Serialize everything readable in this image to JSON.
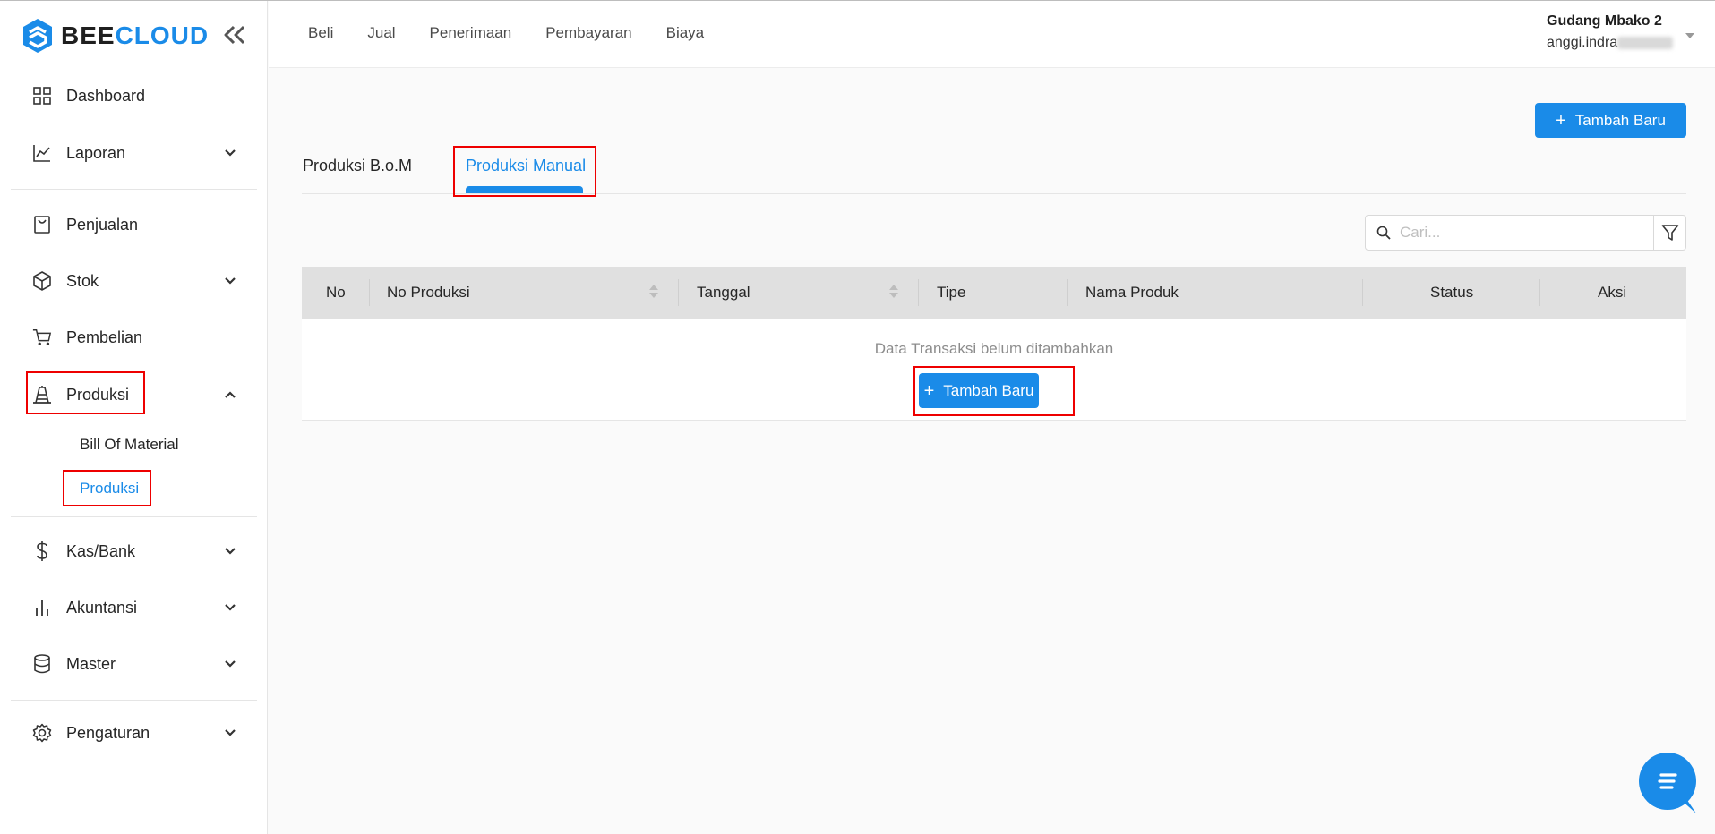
{
  "brand": {
    "part1": "BEE",
    "part2": "CLOUD"
  },
  "sidebar": {
    "items": [
      {
        "label": "Dashboard",
        "icon": "dashboard-grid-icon"
      },
      {
        "label": "Laporan",
        "icon": "line-chart-icon"
      },
      {
        "label": "Penjualan",
        "icon": "shopping-bag-icon"
      },
      {
        "label": "Stok",
        "icon": "box-icon"
      },
      {
        "label": "Pembelian",
        "icon": "cart-icon"
      },
      {
        "label": "Produksi",
        "icon": "production-icon"
      },
      {
        "label": "Kas/Bank",
        "icon": "dollar-icon"
      },
      {
        "label": "Akuntansi",
        "icon": "bar-chart-icon"
      },
      {
        "label": "Master",
        "icon": "database-icon"
      },
      {
        "label": "Pengaturan",
        "icon": "gear-icon"
      }
    ],
    "produksi_sub": [
      {
        "label": "Bill Of Material"
      },
      {
        "label": "Produksi"
      }
    ]
  },
  "topnav": [
    "Beli",
    "Jual",
    "Penerimaan",
    "Pembayaran",
    "Biaya"
  ],
  "user": {
    "warehouse": "Gudang Mbako 2",
    "email_prefix": "anggi.indra"
  },
  "main": {
    "add_button": "Tambah Baru",
    "tabs": [
      {
        "label": "Produksi B.o.M"
      },
      {
        "label": "Produksi Manual"
      }
    ],
    "search_placeholder": "Cari...",
    "table": {
      "columns": [
        "No",
        "No Produksi",
        "Tanggal",
        "Tipe",
        "Nama Produk",
        "Status",
        "Aksi"
      ],
      "empty_text": "Data Transaksi belum ditambahkan",
      "empty_add_button": "Tambah Baru"
    }
  },
  "colors": {
    "primary": "#1a8be8",
    "highlight": "#e00000"
  }
}
